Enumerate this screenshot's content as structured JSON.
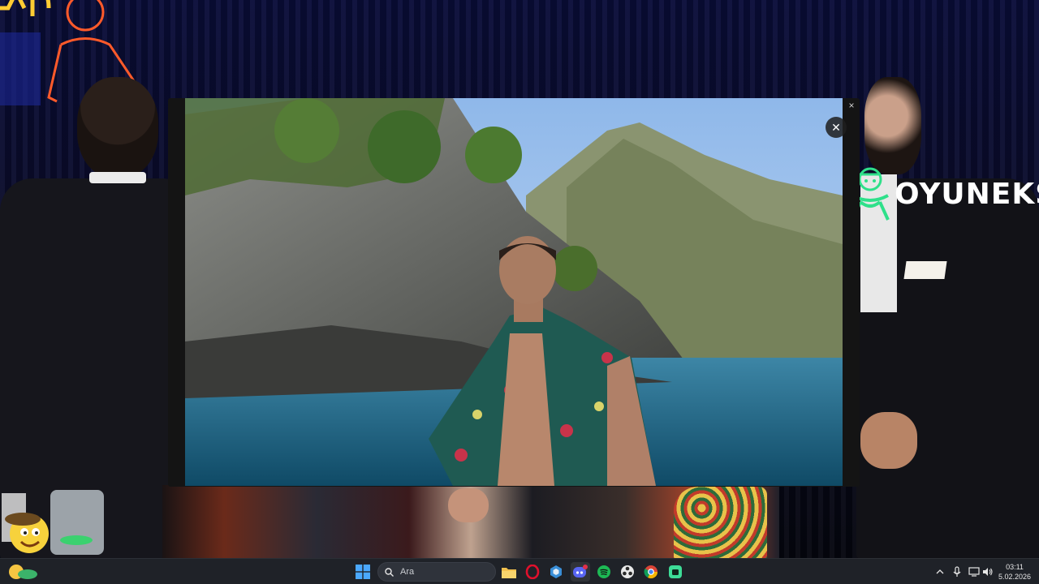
{
  "brand": {
    "name": "OYUNEKS"
  },
  "viewer": {
    "close_label": "×",
    "photo_close_label": "✕"
  },
  "taskbar": {
    "search_placeholder": "Ara",
    "apps": [
      {
        "name": "file-explorer-icon"
      },
      {
        "name": "opera-gx-icon"
      },
      {
        "name": "app-hexagon-icon"
      },
      {
        "name": "discord-icon",
        "badge": "1"
      },
      {
        "name": "spotify-icon"
      },
      {
        "name": "obs-icon"
      },
      {
        "name": "chrome-icon"
      },
      {
        "name": "green-app-icon"
      }
    ],
    "tray_icons": [
      "chevron-up-icon",
      "microphone-icon",
      "network-icon",
      "volume-icon"
    ],
    "time": "03:11",
    "date": "5.02.2026"
  },
  "colors": {
    "taskbar_bg": "#1f2228",
    "brand_green": "#2fe08a",
    "discord": "#5865f2",
    "spotify": "#1db954",
    "opera": "#e0102c",
    "folder": "#f2c14e"
  }
}
